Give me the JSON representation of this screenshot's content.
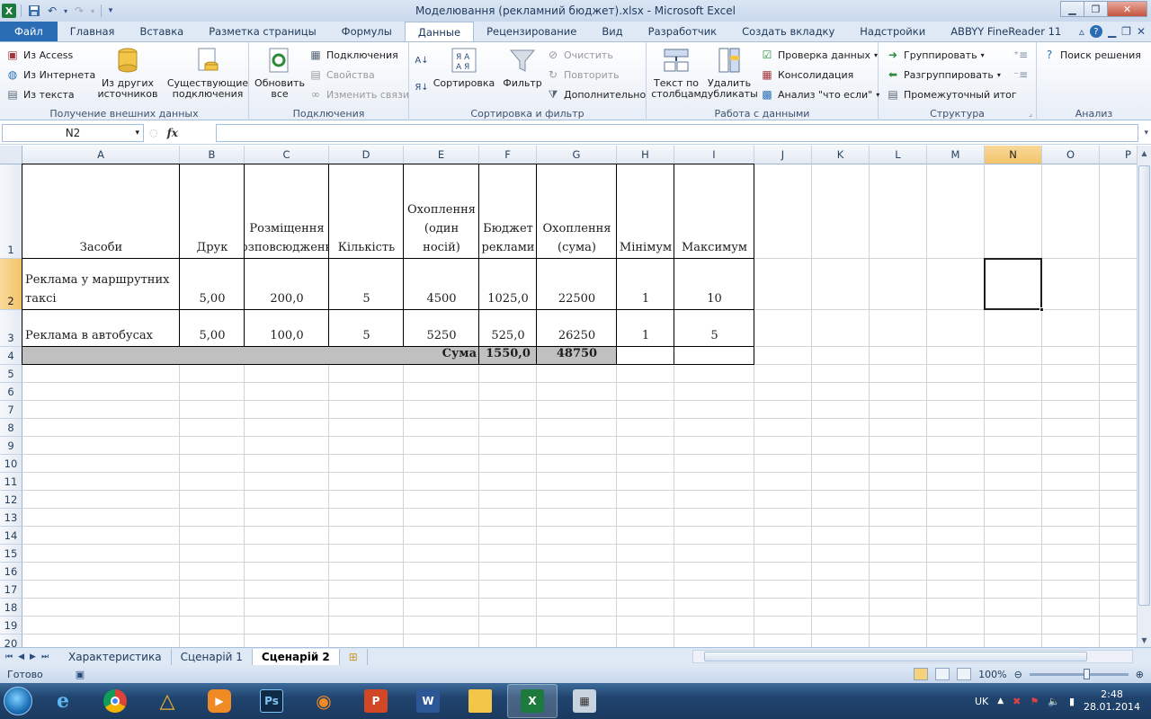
{
  "window": {
    "title": "Моделювання (рекламний бюджет).xlsx - Microsoft Excel",
    "logo": "X"
  },
  "tabs": [
    "Файл",
    "Главная",
    "Вставка",
    "Разметка страницы",
    "Формулы",
    "Данные",
    "Рецензирование",
    "Вид",
    "Разработчик",
    "Создать вкладку",
    "Надстройки",
    "ABBYY FineReader 11"
  ],
  "active_tab": "Данные",
  "ribbon": {
    "external": {
      "label": "Получение внешних данных",
      "access": "Из Access",
      "web": "Из Интернета",
      "text": "Из текста",
      "other": "Из других источников",
      "existing": "Существующие подключения"
    },
    "connections": {
      "label": "Подключения",
      "refresh": "Обновить все",
      "connections": "Подключения",
      "properties": "Свойства",
      "edit_links": "Изменить связи"
    },
    "sort_filter": {
      "label": "Сортировка и фильтр",
      "sort": "Сортировка",
      "filter": "Фильтр",
      "clear": "Очистить",
      "reapply": "Повторить",
      "advanced": "Дополнительно"
    },
    "data_tools": {
      "label": "Работа с данными",
      "text_to_columns": "Текст по столбцам",
      "remove_duplicates": "Удалить дубликаты",
      "validation": "Проверка данных",
      "consolidate": "Консолидация",
      "what_if": "Анализ \"что если\""
    },
    "outline": {
      "label": "Структура",
      "group": "Группировать",
      "ungroup": "Разгруппировать",
      "subtotal": "Промежуточный итог"
    },
    "analysis": {
      "label": "Анализ",
      "solver": "Поиск решения"
    }
  },
  "formula_bar": {
    "name_box": "N2",
    "fx": "fx",
    "formula": ""
  },
  "columns": [
    "A",
    "B",
    "C",
    "D",
    "E",
    "F",
    "G",
    "H",
    "I",
    "J",
    "K",
    "L",
    "M",
    "N",
    "O",
    "P"
  ],
  "rows": [
    "1",
    "2",
    "3",
    "4",
    "5",
    "6",
    "7",
    "8",
    "9",
    "10",
    "11",
    "12",
    "13",
    "14",
    "15",
    "16",
    "17",
    "18",
    "19",
    "20"
  ],
  "sheet": {
    "headers": {
      "A": "Засоби",
      "B": "Друк",
      "C": "Розміщення (розповсюдження)",
      "D": "Кількість",
      "E": "Охоплення (один носій)",
      "F": "Бюджет реклами",
      "G": "Охоплення (сума)",
      "H": "Мінімум",
      "I": "Максимум"
    },
    "row2": {
      "A": "Реклама у маршрутних таксі",
      "B": "5,00",
      "C": "200,0",
      "D": "5",
      "E": "4500",
      "F": "1025,0",
      "G": "22500",
      "H": "1",
      "I": "10"
    },
    "row3": {
      "A": "Реклама в автобусах",
      "B": "5,00",
      "C": "100,0",
      "D": "5",
      "E": "5250",
      "F": "525,0",
      "G": "26250",
      "H": "1",
      "I": "5"
    },
    "row4": {
      "label": "Сума",
      "F": "1550,0",
      "G": "48750"
    }
  },
  "sheet_tabs": [
    "Характеристика",
    "Сценарій 1",
    "Сценарій 2"
  ],
  "active_sheet": "Сценарій 2",
  "status": {
    "ready": "Готово",
    "zoom": "100%"
  },
  "taskbar": {
    "language": "UK",
    "time": "2:48",
    "date": "28.01.2014"
  },
  "colors": {
    "ribbon_accent": "#2a6db5",
    "selected_header": "#f2c46a",
    "sum_row_fill": "#c0c0c0"
  }
}
